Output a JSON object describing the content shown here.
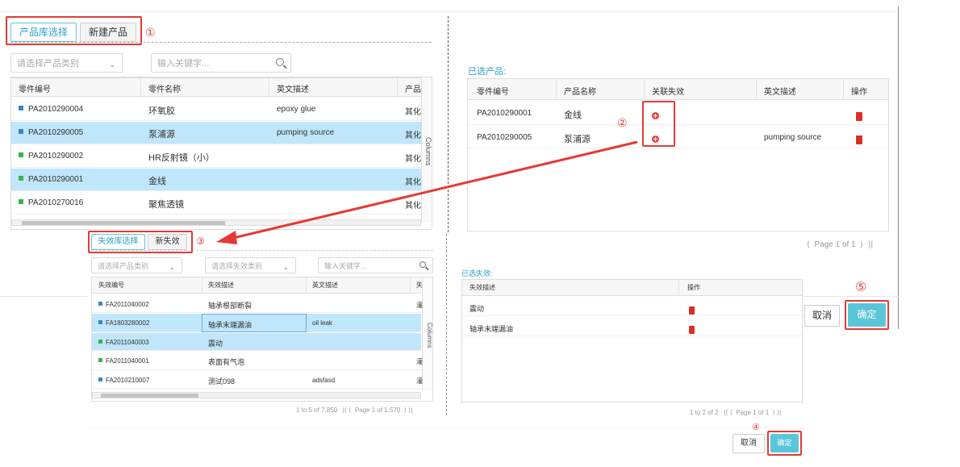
{
  "top": {
    "tabs": [
      {
        "label": "产品库选择",
        "active": true
      },
      {
        "label": "新建产品",
        "active": false
      }
    ],
    "marker1": "①",
    "category_placeholder": "请选择产品类别",
    "keyword_placeholder": "输入关键字...",
    "grid": {
      "columns": [
        "零件编号",
        "零件名称",
        "英文描述",
        "产品"
      ],
      "side_tab": "Columns",
      "rows": [
        {
          "code": "PA2010290004",
          "name": "环氧胶",
          "en": "epoxy glue",
          "type": "其化",
          "color": "#3d86c6",
          "selected": false
        },
        {
          "code": "PA2010290005",
          "name": "泵浦源",
          "en": "pumping source",
          "type": "其化",
          "color": "#3d86c6",
          "selected": true
        },
        {
          "code": "PA2010290002",
          "name": "HR反射镜（小）",
          "en": "",
          "type": "其化",
          "color": "#3bb44a",
          "selected": false
        },
        {
          "code": "PA2010290001",
          "name": "金线",
          "en": "",
          "type": "其化",
          "color": "#3bb44a",
          "selected": true
        },
        {
          "code": "PA2010270016",
          "name": "聚焦透镜",
          "en": "",
          "type": "其化",
          "color": "#3bb44a",
          "selected": false
        }
      ]
    },
    "selected_title": "已选产品:",
    "selected_grid": {
      "columns": [
        "零件编号",
        "产品名称",
        "关联失效",
        "英文描述",
        "操作"
      ],
      "rows": [
        {
          "code": "PA2010290001",
          "name": "金线",
          "en": ""
        },
        {
          "code": "PA2010290005",
          "name": "泵浦源",
          "en": "pumping source"
        }
      ]
    },
    "marker2": "②",
    "pager": "Page 1 of 1",
    "cancel": "取消",
    "confirm": "确定",
    "marker5": "⑤"
  },
  "bottom": {
    "tabs": [
      {
        "label": "失效库选择",
        "active": true
      },
      {
        "label": "新失效",
        "active": false
      }
    ],
    "marker3": "③",
    "category_placeholder": "请选择产品类别",
    "failure_category_placeholder": "请选择失效类别",
    "keyword_placeholder": "输入关键字...",
    "grid": {
      "columns": [
        "失效编号",
        "失效描述",
        "英文描述",
        "失"
      ],
      "side_tab": "Columns",
      "rows": [
        {
          "code": "FA2011040002",
          "desc": "轴承根部断裂",
          "en": "",
          "type": "灌",
          "color": "#3d86c6",
          "selected": false
        },
        {
          "code": "FA1803280002",
          "desc": "轴承末端漏油",
          "en": "oil leak",
          "type": "",
          "color": "#3d86c6",
          "selected": true
        },
        {
          "code": "FA2011040003",
          "desc": "震动",
          "en": "",
          "type": "",
          "color": "#3bb44a",
          "selected": true
        },
        {
          "code": "FA2011040001",
          "desc": "表面有气泡",
          "en": "",
          "type": "灌",
          "color": "#3bb44a",
          "selected": false
        },
        {
          "code": "FA2010210007",
          "desc": "测试098",
          "en": "adsfasd",
          "type": "灌",
          "color": "#3d86c6",
          "selected": false
        }
      ],
      "pager": "1 to 5 of 7,850",
      "page": "Page 1 of 1,570"
    },
    "selected_title": "已选失效:",
    "selected_grid": {
      "columns": [
        "失效描述",
        "操作"
      ],
      "rows": [
        {
          "desc": "震动"
        },
        {
          "desc": "轴承末端漏油"
        }
      ],
      "pager": "1 to 2 of 2",
      "page": "Page 1 of 1"
    },
    "marker4": "④",
    "cancel": "取消",
    "confirm": "确定"
  },
  "colors": {
    "accent": "#5bc6d9",
    "annotation": "#e53935",
    "arrow": "#e53935",
    "selected_row": "#bfe6fb"
  }
}
